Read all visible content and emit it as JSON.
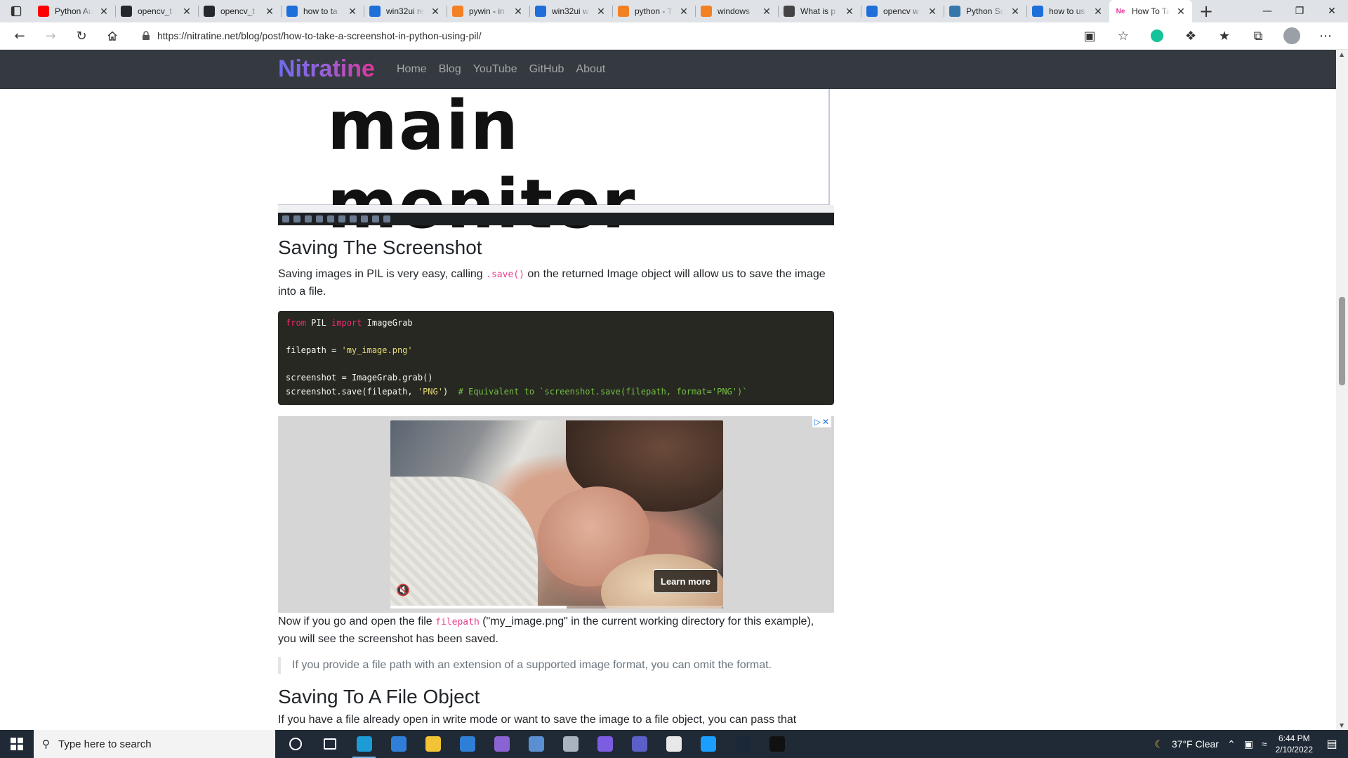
{
  "browser": {
    "tabs": [
      {
        "title": "Python Au",
        "favicon": "youtube-icon",
        "color": "#ff0000"
      },
      {
        "title": "opencv_t",
        "favicon": "github-icon",
        "color": "#24292e"
      },
      {
        "title": "opencv_t",
        "favicon": "github-icon",
        "color": "#24292e"
      },
      {
        "title": "how to ta",
        "favicon": "bing-icon",
        "color": "#1e6fd9"
      },
      {
        "title": "win32ui re",
        "favicon": "bing-icon",
        "color": "#1e6fd9"
      },
      {
        "title": "pywin - in",
        "favicon": "stackoverflow-icon",
        "color": "#f48024"
      },
      {
        "title": "win32ui w",
        "favicon": "bing-icon",
        "color": "#1e6fd9"
      },
      {
        "title": "python - T",
        "favicon": "stackoverflow-icon",
        "color": "#f48024"
      },
      {
        "title": "windows",
        "favicon": "stackoverflow-icon",
        "color": "#f48024"
      },
      {
        "title": "What is p",
        "favicon": "document-icon",
        "color": "#444444"
      },
      {
        "title": "opencv w",
        "favicon": "bing-icon",
        "color": "#1e6fd9"
      },
      {
        "title": "Python Sc",
        "favicon": "python-icon",
        "color": "#3776ab"
      },
      {
        "title": "how to us",
        "favicon": "bing-icon",
        "color": "#1e6fd9"
      },
      {
        "title": "How To Ta",
        "favicon": "nitratine-icon",
        "color": "#e2339b",
        "label": "Ne",
        "active": true
      }
    ],
    "url": "https://nitratine.net/blog/post/how-to-take-a-screenshot-in-python-using-pil/"
  },
  "site": {
    "brand": "Nitratine",
    "nav": [
      "Home",
      "Blog",
      "YouTube",
      "GitHub",
      "About"
    ]
  },
  "article": {
    "image_text": "main monitor",
    "heading1": "Saving The Screenshot",
    "p1_before": "Saving images in PIL is very easy, calling ",
    "p1_code": ".save()",
    "p1_after": " on the returned Image object will allow us to save the image into a file.",
    "code": {
      "line1_kw1": "from",
      "line1_mod": " PIL ",
      "line1_kw2": "import",
      "line1_rest": " ImageGrab",
      "line3_lhs": "filepath = ",
      "line3_str": "'my_image.png'",
      "line5": "screenshot = ImageGrab.grab()",
      "line6_code": "screenshot.save(filepath, ",
      "line6_str": "'PNG'",
      "line6_close": ")  ",
      "line6_comment": "# Equivalent to `screenshot.save(filepath, format='PNG')`"
    },
    "ad": {
      "cta": "Learn more"
    },
    "p2_before": "Now if you go and open the file ",
    "p2_code": "filepath",
    "p2_after": " (\"my_image.png\" in the current working directory for this example), you will see the screenshot has been saved.",
    "quote": "If you provide a file path with an extension of a supported image format, you can omit the format.",
    "heading2": "Saving To A File Object",
    "p3": "If you have a file already open in write mode or want to save the image to a file object, you can pass that"
  },
  "taskbar": {
    "search_placeholder": "Type here to search",
    "weather": "37°F  Clear",
    "time": "6:44 PM",
    "date": "2/10/2022",
    "apps": [
      {
        "name": "cortana-icon",
        "color": "#1f2a36"
      },
      {
        "name": "task-view-icon",
        "color": "#1f2a36"
      },
      {
        "name": "edge-icon",
        "color": "#1c9bd6",
        "active": true
      },
      {
        "name": "store-icon",
        "color": "#2f7fd8"
      },
      {
        "name": "file-explorer-icon",
        "color": "#f2c335"
      },
      {
        "name": "mail-icon",
        "color": "#2f7fd8"
      },
      {
        "name": "visual-studio-icon",
        "color": "#8a63d2"
      },
      {
        "name": "app-cube-icon",
        "color": "#5a8fd1"
      },
      {
        "name": "snip-icon",
        "color": "#a9b4c0"
      },
      {
        "name": "discord-icon",
        "color": "#7c5ce0"
      },
      {
        "name": "teams-icon",
        "color": "#5b5fc7"
      },
      {
        "name": "file-viewer-icon",
        "color": "#e8e8e8"
      },
      {
        "name": "steam-alt-icon",
        "color": "#1a9fff"
      },
      {
        "name": "steam-icon",
        "color": "#1b2838"
      },
      {
        "name": "terminal-icon",
        "color": "#111111"
      }
    ]
  }
}
